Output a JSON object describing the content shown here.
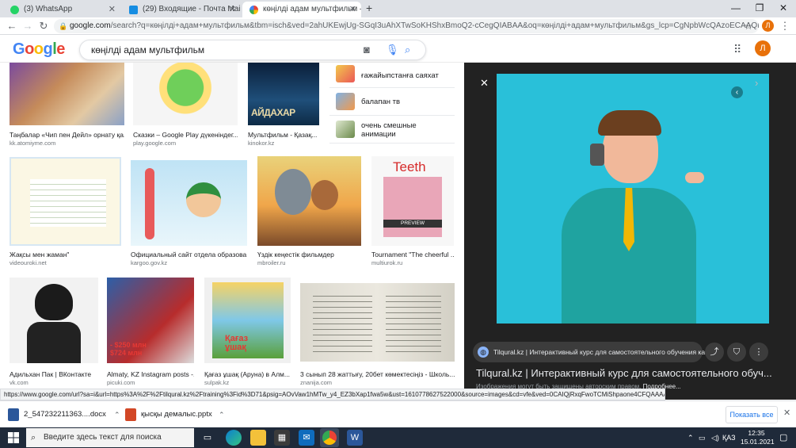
{
  "browser": {
    "tabs": [
      {
        "label": "(3) WhatsApp",
        "active": false
      },
      {
        "label": "(29) Входящие - Почта Mail.ru",
        "active": false
      },
      {
        "label": "көңілді адам мультфильм – Goo",
        "active": true
      }
    ],
    "new_tab": "+",
    "url_host": "google.com",
    "url_rest": "/search?q=көңілді+адам+мультфильм&tbm=isch&ved=2ahUKEwjUg-SGqI3uAhXTwSoKHShxBmoQ2-cCegQIABAA&oq=көңілді+адам+мультфильм&gs_lcp=CgNpbWcQAzoECAAQHlDnU1iJgQFgy44BaAB...",
    "profile_letter": "Л"
  },
  "google": {
    "logo_letters": [
      "G",
      "o",
      "o",
      "g",
      "l",
      "e"
    ],
    "query": "көңілді адам мультфильм",
    "avatar": "Л"
  },
  "results": [
    {
      "caption": "Таңбалар «Чип пен Дейл» орнату қа...",
      "source": "kk.atomiyme.com"
    },
    {
      "caption": "Сказки – Google Play дүкеніндег...",
      "source": "play.google.com"
    },
    {
      "caption": "Мультфильм - Қазақ...",
      "source": "kinokor.kz",
      "overlay": "АЙДАХАР"
    },
    {
      "caption": "Жақсы мен жаман\"",
      "source": "videouroki.net"
    },
    {
      "caption": "Официальный сайт отдела образова...",
      "source": "kargoo.gov.kz"
    },
    {
      "caption": "Үздік кеңестік фильмдер",
      "source": "mbroiler.ru"
    },
    {
      "caption": "Tournament \"The cheerful ...",
      "source": "multiurok.ru",
      "overlay": "Teeth",
      "badge": "PREVIEW"
    },
    {
      "caption": "Адильхан Пак | ВКонтакте",
      "source": "vk.com"
    },
    {
      "caption": "Almaty, KZ Instagram posts -...",
      "source": "picuki.com",
      "overlay": "- $250 млн\n$724 млн"
    },
    {
      "caption": "Қағаз ұшақ (Аруна) в Алм...",
      "source": "sulpak.kz",
      "overlay": "Қағаз\nұшақ"
    },
    {
      "caption": "3 сынып 28 жаттығу, 20бет көмектесіңіз - Школь...",
      "source": "znanija.com"
    }
  ],
  "related": [
    {
      "label": "ғажайыпстанға саяхат"
    },
    {
      "label": "балапан тв"
    },
    {
      "label": "очень смешные\nанимации"
    }
  ],
  "preview": {
    "site_line": "Tilqural.kz | Интерактивный курс для самостоятельного обучения каза...",
    "title": "Tilqural.kz | Интерактивный курс для самостоятельного обуч...",
    "notice": "Изображения могут быть защищены авторским правом.",
    "more": "Подробнее..."
  },
  "status_url": "https://www.google.com/url?sa=i&url=https%3A%2F%2Ftilqural.kz%2Ftraining%3Fid%3D71&psig=AOvVaw1hMTw_y4_EZ3bXap1fwa5w&ust=1610778627522000&source=images&cd=vfe&ved=0CAIQjRxqFwoTCMiShpaone4CFQAAAAAdAAAAABBd",
  "downloads": {
    "items": [
      {
        "name": "2_547232211363....docx"
      },
      {
        "name": "қысқы демалыс.pptx"
      }
    ],
    "show_all": "Показать все"
  },
  "taskbar": {
    "search_placeholder": "Введите здесь текст для поиска",
    "lang": "ҚАЗ",
    "time": "12:35",
    "date": "15.01.2021"
  },
  "colors": {
    "google_blue": "#4285f4",
    "google_red": "#ea4335",
    "google_yellow": "#fbbc05",
    "google_green": "#34a853",
    "profile_orange": "#e8710a",
    "taskbar": "#1f2a3a"
  }
}
